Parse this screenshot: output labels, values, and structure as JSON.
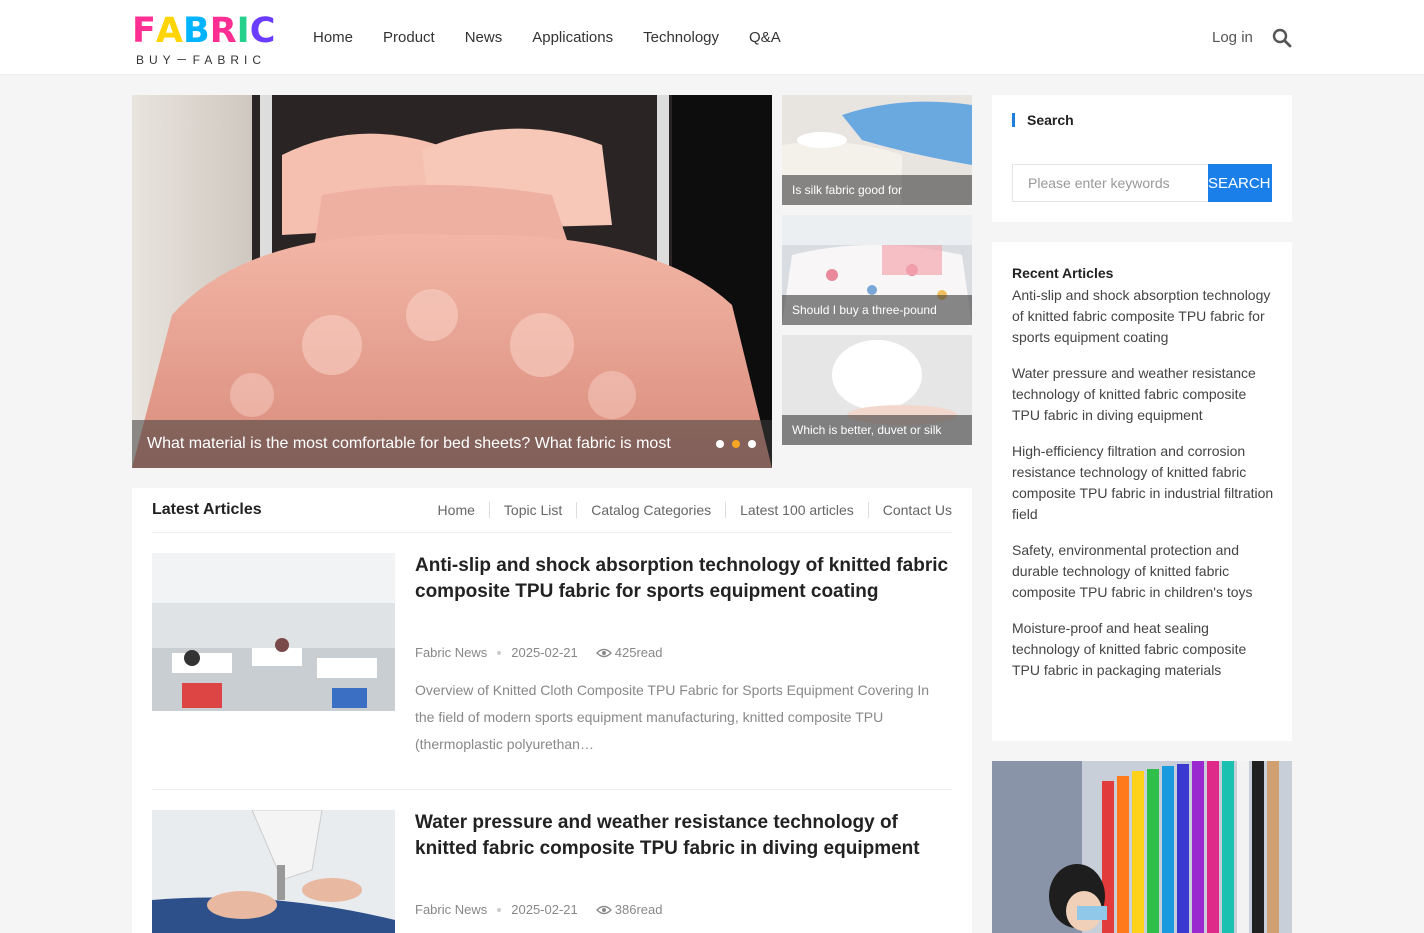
{
  "logo": {
    "word": [
      "F",
      "A",
      "B",
      "R",
      "I",
      "C"
    ],
    "word_colors": [
      "#ff2e93",
      "#ffd400",
      "#00b4ff",
      "#ff2e93",
      "#24d08a",
      "#6a3cff"
    ],
    "subtitle": "BUY－FABRIC"
  },
  "nav": {
    "items": [
      "Home",
      "Product",
      "News",
      "Applications",
      "Technology",
      "Q&A"
    ],
    "login": "Log in"
  },
  "hero": {
    "caption": "What material is the most comfortable for bed sheets? What fabric is most",
    "active_slide": 2,
    "slide_count": 3
  },
  "thumbs": [
    {
      "caption": "Is silk fabric good for"
    },
    {
      "caption": "Should I buy a three-pound"
    },
    {
      "caption": "Which is better, duvet or silk"
    }
  ],
  "latest": {
    "title": "Latest Articles",
    "subnav": [
      "Home",
      "Topic List",
      "Catalog Categories",
      "Latest 100 articles",
      "Contact Us"
    ],
    "articles": [
      {
        "title": "Anti-slip and shock absorption technology of knitted fabric composite TPU fabric for sports equipment coating",
        "category": "Fabric News",
        "date": "2025-02-21",
        "reads": "425read",
        "excerpt": "Overview of Knitted Cloth Composite TPU Fabric for Sports Equipment Covering In the field of modern sports equipment manufacturing, knitted composite TPU (thermoplastic polyurethan…"
      },
      {
        "title": "Water pressure and weather resistance technology of knitted fabric composite TPU fabric in diving equipment",
        "category": "Fabric News",
        "date": "2025-02-21",
        "reads": "386read"
      }
    ]
  },
  "sidebar": {
    "search_label": "Search",
    "search_placeholder": "Please enter keywords",
    "search_button": "SEARCH",
    "recent_title": "Recent Articles",
    "recent": [
      "Anti-slip and shock absorption technology of knitted fabric composite TPU fabric for sports equipment coating",
      "Water pressure and weather resistance technology of knitted fabric composite TPU fabric in diving equipment",
      "High-efficiency filtration and corrosion resistance technology of knitted fabric composite TPU fabric in industrial filtration field",
      "Safety, environmental protection and durable technology of knitted fabric composite TPU fabric in children's toys",
      "Moisture-proof and heat sealing technology of knitted fabric composite TPU fabric in packaging materials"
    ]
  },
  "colors": {
    "accent": "#1a7fe8",
    "active_dot": "#f5a623"
  }
}
